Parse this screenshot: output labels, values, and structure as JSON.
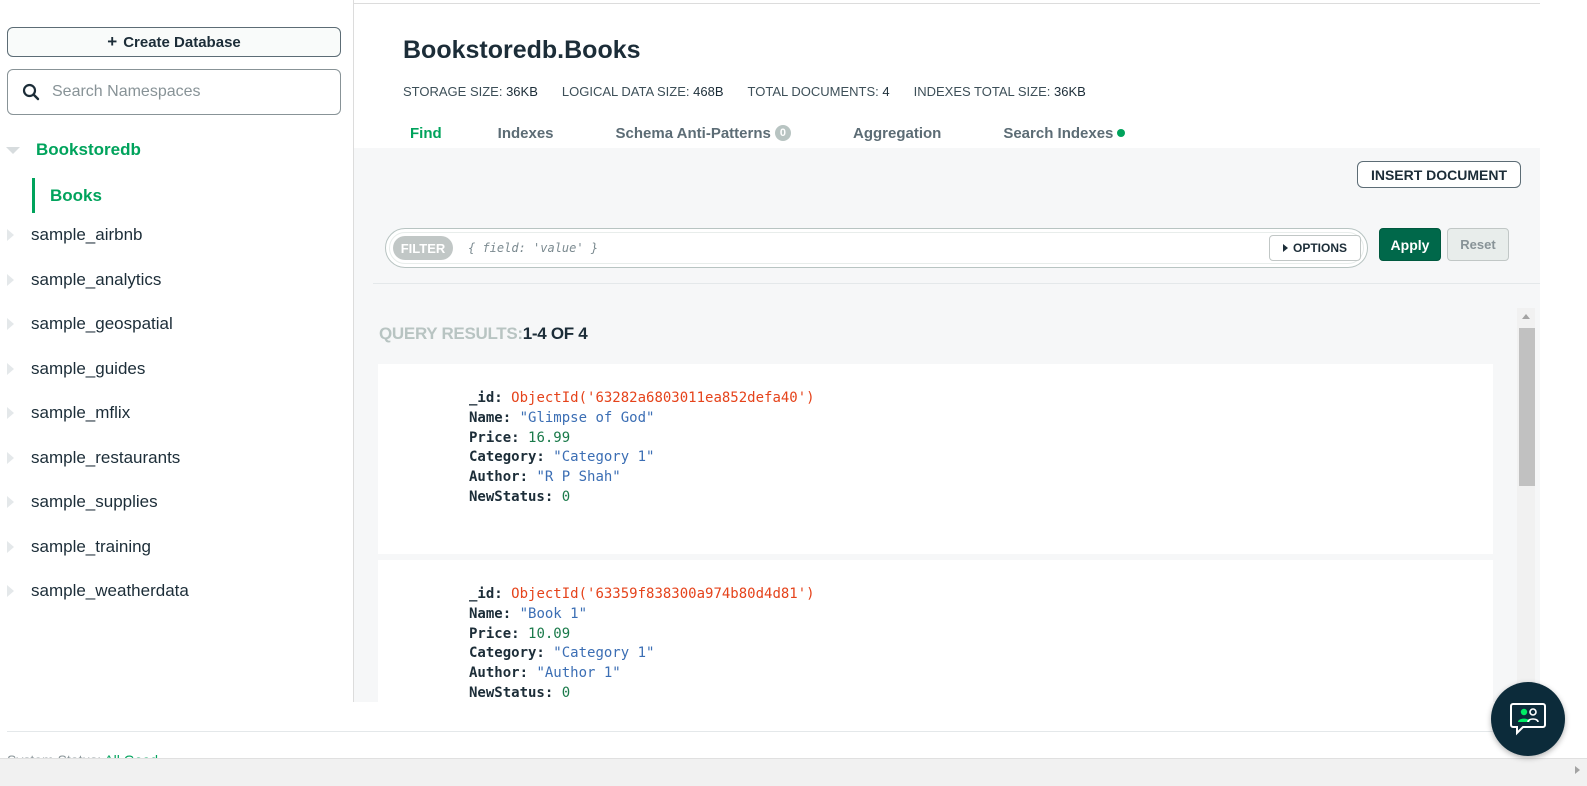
{
  "sidebar": {
    "create_database_label": "Create Database",
    "search_placeholder": "Search Namespaces",
    "active_database": "Bookstoredb",
    "active_collection": "Books",
    "databases": [
      "sample_airbnb",
      "sample_analytics",
      "sample_geospatial",
      "sample_guides",
      "sample_mflix",
      "sample_restaurants",
      "sample_supplies",
      "sample_training",
      "sample_weatherdata"
    ]
  },
  "header": {
    "namespace_title": "Bookstoredb.Books",
    "stats": [
      {
        "label": "STORAGE SIZE:",
        "value": "36KB"
      },
      {
        "label": "LOGICAL DATA SIZE:",
        "value": "468B"
      },
      {
        "label": "TOTAL DOCUMENTS:",
        "value": "4"
      },
      {
        "label": "INDEXES TOTAL SIZE:",
        "value": "36KB"
      }
    ]
  },
  "tabs": {
    "find": "Find",
    "indexes": "Indexes",
    "schema": "Schema Anti-Patterns",
    "schema_badge": "0",
    "aggregation": "Aggregation",
    "search_indexes": "Search Indexes"
  },
  "toolbar": {
    "insert_document": "INSERT DOCUMENT",
    "filter_label": "FILTER",
    "filter_placeholder": "{ field: 'value' }",
    "options_label": "OPTIONS",
    "apply_label": "Apply",
    "reset_label": "Reset"
  },
  "results": {
    "label": "QUERY RESULTS:",
    "count": "1-4 OF 4"
  },
  "documents": [
    {
      "id_key": "_id:",
      "id_value": "ObjectId('63282a6803011ea852defa40')",
      "name_key": "Name:",
      "name_value": "\"Glimpse of God\"",
      "price_key": "Price:",
      "price_value": "16.99",
      "category_key": "Category:",
      "category_value": "\"Category 1\"",
      "author_key": "Author:",
      "author_value": "\"R P Shah\"",
      "status_key": "NewStatus:",
      "status_value": "0"
    },
    {
      "id_key": "_id:",
      "id_value": "ObjectId('63359f838300a974b80d4d81')",
      "name_key": "Name:",
      "name_value": "\"Book 1\"",
      "price_key": "Price:",
      "price_value": "10.09",
      "category_key": "Category:",
      "category_value": "\"Category 1\"",
      "author_key": "Author:",
      "author_value": "\"Author 1\"",
      "status_key": "NewStatus:",
      "status_value": "0"
    }
  ],
  "footer": {
    "status_label": "System Status:",
    "status_value": "All Good"
  },
  "colors": {
    "accent_green": "#00a35c",
    "apply_green": "#00684a",
    "object_id_red": "#e5431b",
    "string_blue": "#3b6eb4",
    "chat_navy": "#0c2b3a"
  },
  "icons": {
    "search": "search-icon",
    "chat": "chat-support-icon"
  }
}
